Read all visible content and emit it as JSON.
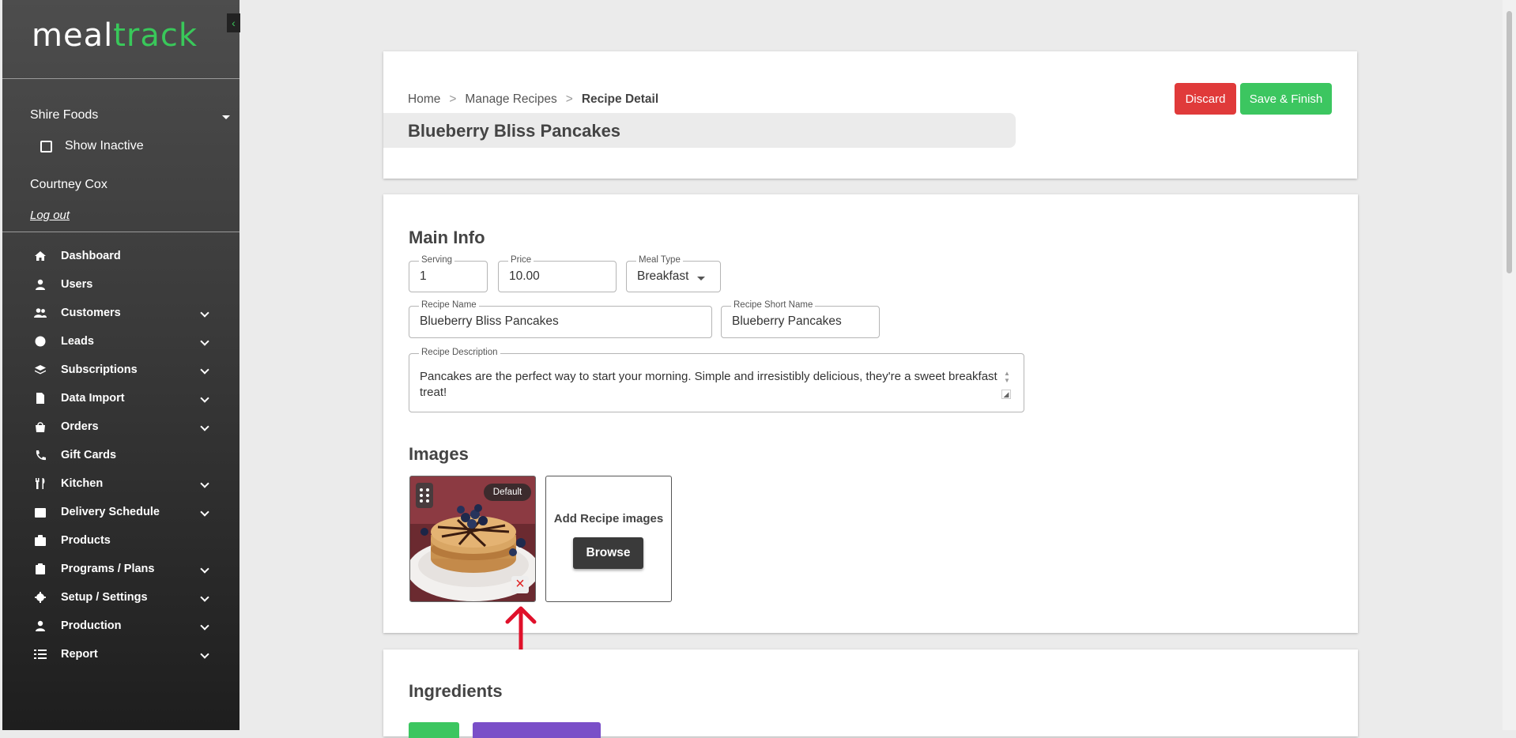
{
  "app": {
    "logo_part1": "meal",
    "logo_part2": "track",
    "brand_color": "#39c85a"
  },
  "sidebar": {
    "organization": "Shire Foods",
    "show_inactive_label": "Show Inactive",
    "user_name": "Courtney Cox",
    "logout_label": "Log out",
    "nav": [
      {
        "label": "Dashboard",
        "icon": "home-icon",
        "expandable": false
      },
      {
        "label": "Users",
        "icon": "user-icon",
        "expandable": false
      },
      {
        "label": "Customers",
        "icon": "users-icon",
        "expandable": true
      },
      {
        "label": "Leads",
        "icon": "dollar-icon",
        "expandable": true
      },
      {
        "label": "Subscriptions",
        "icon": "layers-icon",
        "expandable": true
      },
      {
        "label": "Data Import",
        "icon": "file-icon",
        "expandable": true
      },
      {
        "label": "Orders",
        "icon": "bag-icon",
        "expandable": true
      },
      {
        "label": "Gift Cards",
        "icon": "phone-icon",
        "expandable": false
      },
      {
        "label": "Kitchen",
        "icon": "utensils-icon",
        "expandable": true
      },
      {
        "label": "Delivery Schedule",
        "icon": "calendar-icon",
        "expandable": true
      },
      {
        "label": "Products",
        "icon": "box-icon",
        "expandable": false
      },
      {
        "label": "Programs / Plans",
        "icon": "clipboard-icon",
        "expandable": true
      },
      {
        "label": "Setup / Settings",
        "icon": "gear-icon",
        "expandable": true
      },
      {
        "label": "Production",
        "icon": "user-icon",
        "expandable": true
      },
      {
        "label": "Report",
        "icon": "list-icon",
        "expandable": true
      }
    ]
  },
  "header": {
    "breadcrumb": [
      "Home",
      "Manage Recipes",
      "Recipe Detail"
    ],
    "separator": ">",
    "title": "Blueberry Bliss Pancakes",
    "discard_label": "Discard",
    "save_label": "Save & Finish"
  },
  "main_info": {
    "section_title": "Main Info",
    "serving": {
      "label": "Serving",
      "value": "1"
    },
    "price": {
      "label": "Price",
      "value": "10.00"
    },
    "meal_type": {
      "label": "Meal Type",
      "value": "Breakfast"
    },
    "recipe_name": {
      "label": "Recipe Name",
      "value": "Blueberry Bliss Pancakes"
    },
    "recipe_short_name": {
      "label": "Recipe Short Name",
      "value": "Blueberry Pancakes"
    },
    "recipe_description": {
      "label": "Recipe Description",
      "value": "Pancakes are the perfect way to start your morning. Simple and irresistibly delicious, they're a sweet breakfast treat!"
    }
  },
  "images": {
    "section_title": "Images",
    "default_badge": "Default",
    "add_title": "Add Recipe images",
    "browse_label": "Browse"
  },
  "ingredients": {
    "section_title": "Ingredients"
  },
  "colors": {
    "discard": "#e03a3a",
    "save": "#3cc660",
    "annotation_arrow": "#e0102a"
  }
}
